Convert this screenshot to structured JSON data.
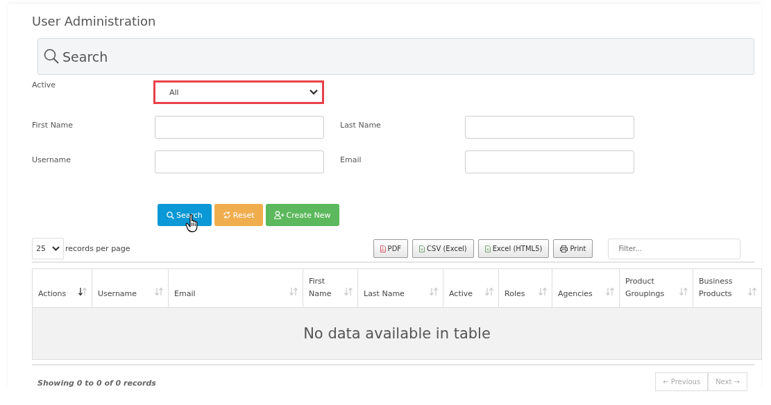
{
  "page_title": "User Administration",
  "search_panel": {
    "placeholder": "Search"
  },
  "filters": [
    {
      "label": "Active",
      "kind": "select",
      "value": "All",
      "highlighted": true
    },
    {
      "label": "First Name",
      "kind": "text"
    },
    {
      "label": "Last Name",
      "kind": "text"
    },
    {
      "label": "Username",
      "kind": "text"
    },
    {
      "label": "Email",
      "kind": "text"
    }
  ],
  "actions": [
    {
      "label": "Search",
      "kind": "search",
      "hovered": true
    },
    {
      "label": "Reset",
      "kind": "reset",
      "hovered": false
    },
    {
      "label": "Create New",
      "kind": "create",
      "hovered": false
    }
  ],
  "page_length": {
    "value": "25",
    "label": "records per page"
  },
  "export_buttons": [
    {
      "label": "PDF",
      "kind": "pdf"
    },
    {
      "label": "CSV (Excel)",
      "kind": "sheet"
    },
    {
      "label": "Excel (HTML5)",
      "kind": "sheet"
    },
    {
      "label": "Print",
      "kind": "print"
    }
  ],
  "filter_field": {
    "placeholder": "Filter..."
  },
  "table": {
    "columns": [
      {
        "label": "Actions",
        "sorted": true
      },
      {
        "label": "Username",
        "sorted": false
      },
      {
        "label": "Email",
        "sorted": false
      },
      {
        "label": "First Name",
        "sorted": false
      },
      {
        "label": "Last Name",
        "sorted": false
      },
      {
        "label": "Active",
        "sorted": false
      },
      {
        "label": "Roles",
        "sorted": false
      },
      {
        "label": "Agencies",
        "sorted": false
      },
      {
        "label": "Product Groupings",
        "sorted": false
      },
      {
        "label": "Business Products",
        "sorted": false
      }
    ],
    "empty_message": "No data available in table"
  },
  "footer": {
    "info": "Showing 0 to 0 of 0 records",
    "pager": [
      {
        "label": "← Previous",
        "disabled": true
      },
      {
        "label": "Next →",
        "disabled": true
      }
    ]
  }
}
